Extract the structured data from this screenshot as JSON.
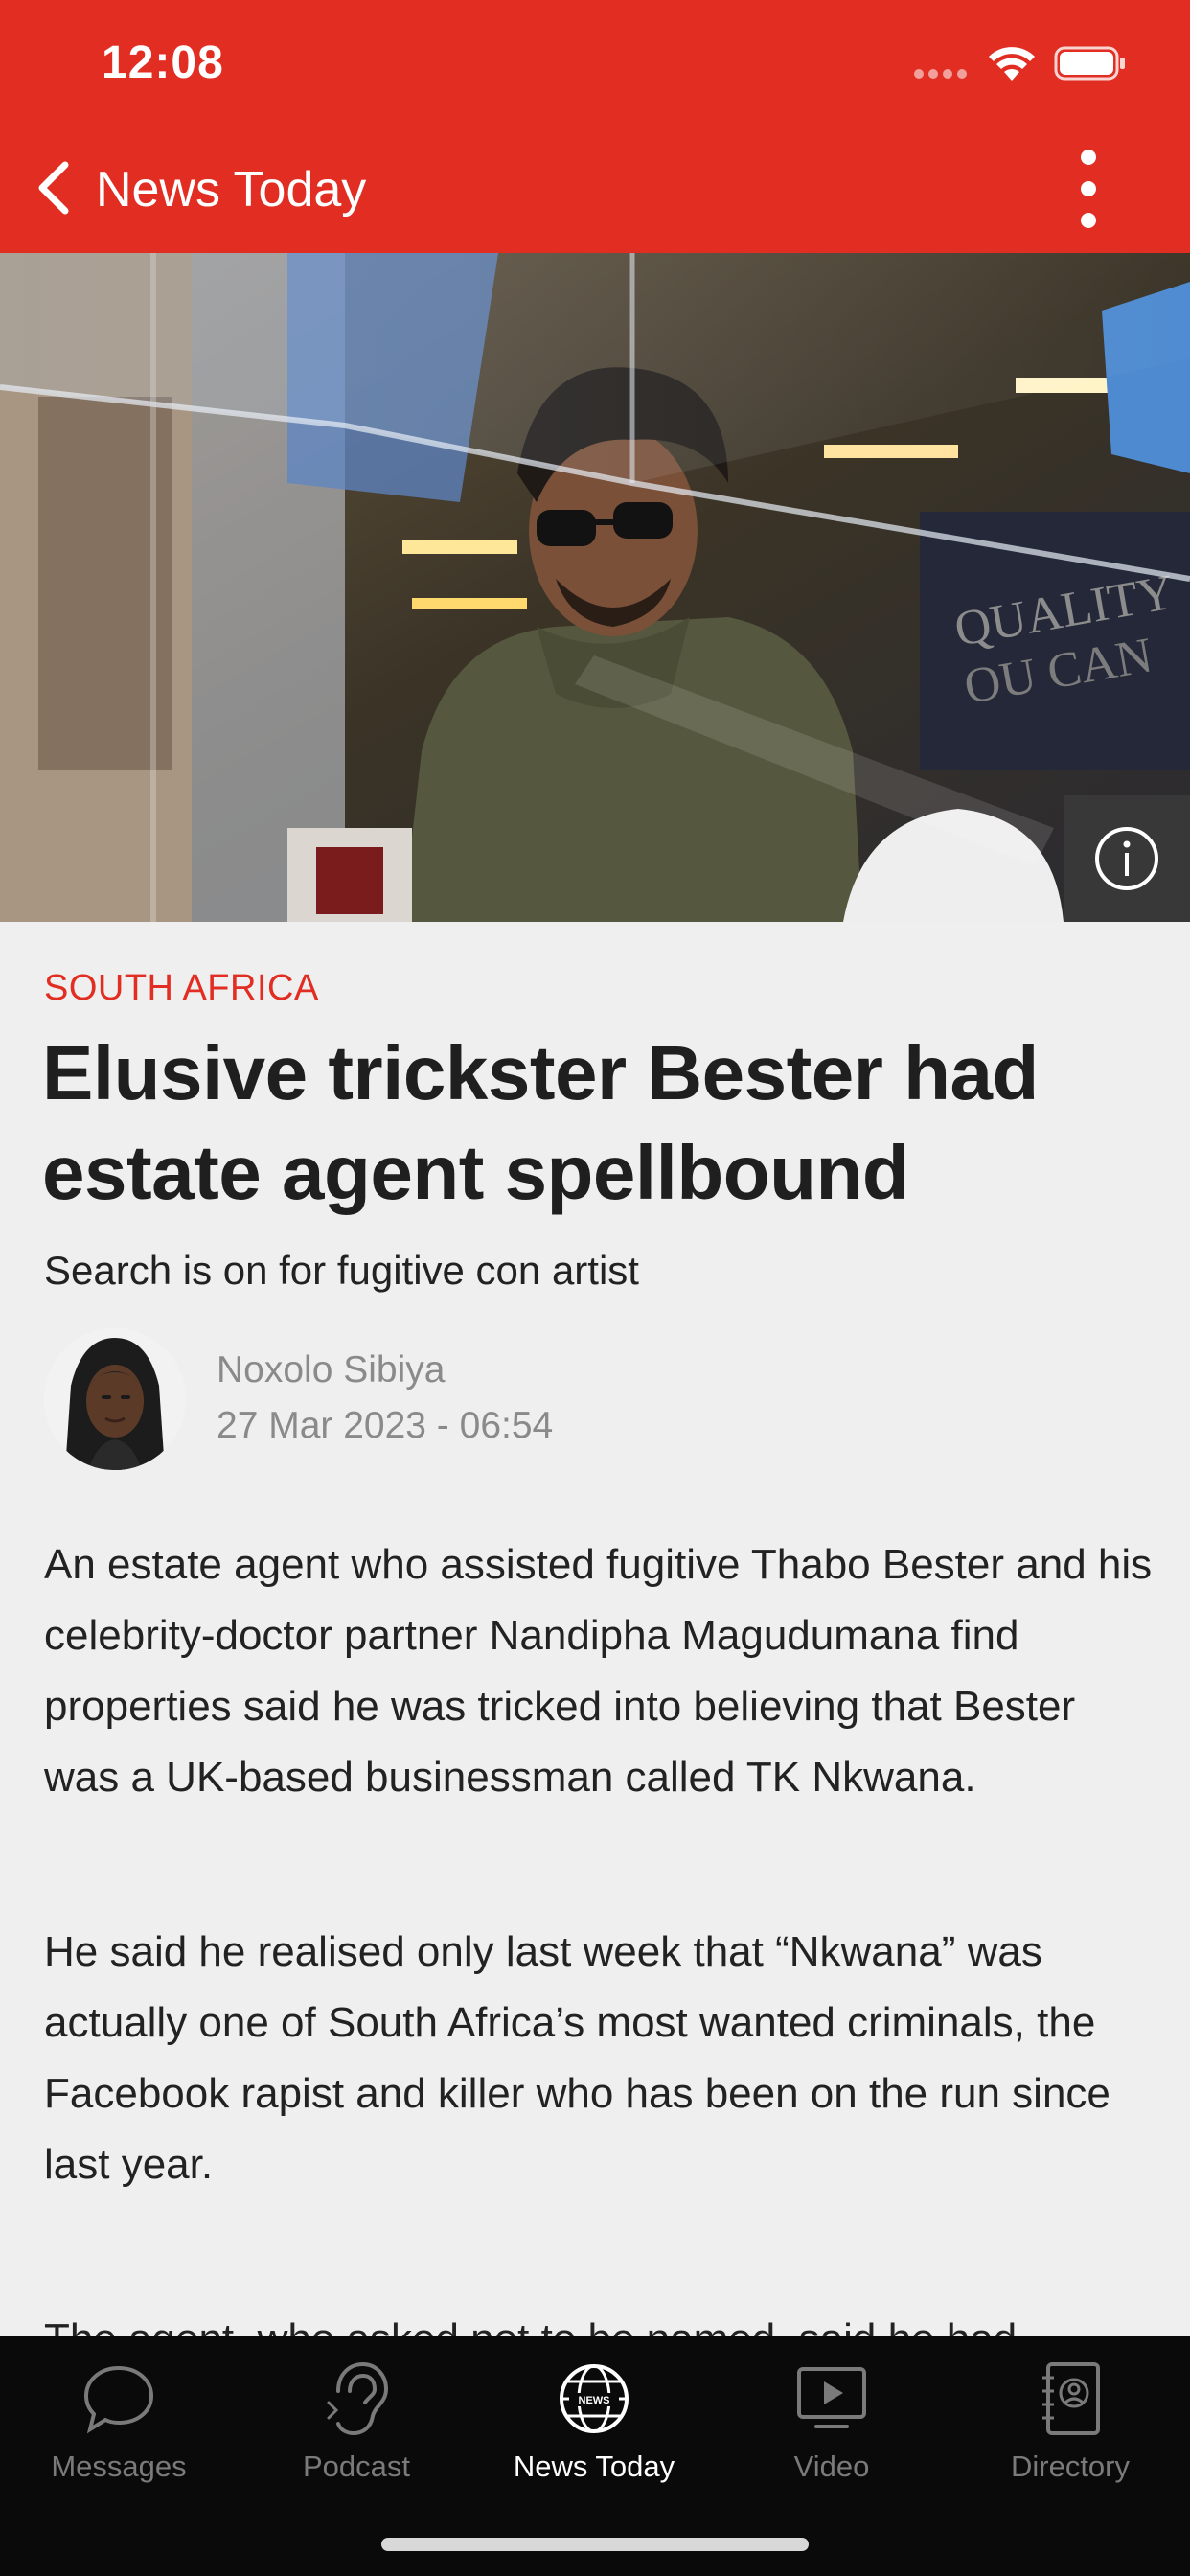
{
  "status_bar": {
    "time": "12:08"
  },
  "nav": {
    "title": "News Today"
  },
  "hero": {
    "image_alt": "Man in sunglasses and olive hoodie behind a glass counter"
  },
  "article": {
    "section": "SOUTH AFRICA",
    "headline": "Elusive trickster Bester had estate agent spellbound",
    "subheadline": "Search is on for fugitive con artist",
    "author": "Noxolo Sibiya",
    "date": "27 Mar 2023 - 06:54",
    "paragraphs": [
      "An estate agent who assisted fugitive Thabo Bester  and his celebrity-doctor partner Nandipha Magudumana find properties said he was tricked into believing that Bester was a UK-based businessman called TK Nkwana.",
      "He said he realised only last week that “Nkwana” was actually one of South Africa’s most wanted criminals, the Facebook rapist and killer who has been on the run since last year.",
      "The agent, who asked not to be named, said he had"
    ]
  },
  "tabs": [
    {
      "label": "Messages",
      "icon": "chat-bubble-icon",
      "active": false
    },
    {
      "label": "Podcast",
      "icon": "ear-icon",
      "active": false
    },
    {
      "label": "News Today",
      "icon": "globe-news-icon",
      "active": true
    },
    {
      "label": "Video",
      "icon": "video-play-icon",
      "active": false
    },
    {
      "label": "Directory",
      "icon": "contacts-book-icon",
      "active": false
    }
  ],
  "colors": {
    "brand_red": "#e12d22",
    "background": "#efefef",
    "tabbar": "#0a0a0a"
  }
}
